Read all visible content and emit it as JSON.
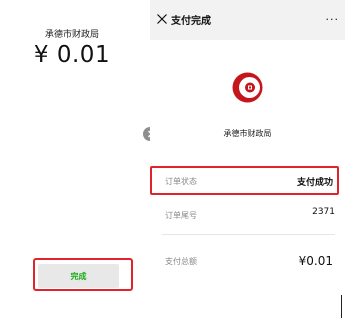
{
  "left_panel": {
    "payee": "承德市财政局",
    "amount": "¥ 0.01",
    "done_button_label": "完成"
  },
  "right_panel": {
    "title": "支付完成",
    "more_label": "···",
    "merchant_name": "承德市财政局",
    "rows": [
      {
        "label": "订单状态",
        "value": "支付成功"
      },
      {
        "label": "订单尾号",
        "value": "2371"
      },
      {
        "label": "支付总额",
        "value": "¥0.01"
      }
    ]
  },
  "colors": {
    "highlight": "#e0242c",
    "done_text": "#1aad19",
    "logo_red": "#c4161c"
  },
  "icons": [
    "close-icon",
    "more-icon",
    "chevron-right-icon",
    "merchant-logo-icon"
  ]
}
